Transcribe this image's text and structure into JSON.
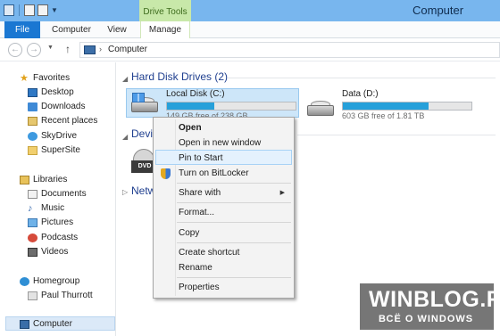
{
  "window": {
    "title": "Computer",
    "context_tab": "Drive Tools"
  },
  "ribbon": {
    "tabs": [
      "File",
      "Computer",
      "View",
      "Manage"
    ]
  },
  "address": {
    "path": "Computer"
  },
  "nav": {
    "favorites": {
      "label": "Favorites",
      "items": [
        "Desktop",
        "Downloads",
        "Recent places",
        "SkyDrive",
        "SuperSite"
      ]
    },
    "libraries": {
      "label": "Libraries",
      "items": [
        "Documents",
        "Music",
        "Pictures",
        "Podcasts",
        "Videos"
      ]
    },
    "homegroup": {
      "label": "Homegroup",
      "items": [
        "Paul Thurrott"
      ]
    },
    "computer": {
      "label": "Computer"
    }
  },
  "content": {
    "groups": {
      "hard_disk_drives": "Hard Disk Drives (2)",
      "devices_partial": "Devi",
      "network_partial": "Netw"
    },
    "drives": [
      {
        "name": "Local Disk (C:)",
        "free_text": "149 GB free of 238 GB",
        "used_fraction": 0.37
      },
      {
        "name": "Data (D:)",
        "free_text": "603 GB free of 1.81 TB",
        "used_fraction": 0.67
      }
    ],
    "dvd_label": "DVD"
  },
  "context_menu": {
    "items": [
      "Open",
      "Open in new window",
      "Pin to Start",
      "Turn on BitLocker",
      "Share with",
      "Format...",
      "Copy",
      "Create shortcut",
      "Rename",
      "Properties"
    ]
  },
  "watermark": {
    "title": "WINBLOG.RU",
    "subtitle": "ВСЁ О WINDOWS"
  },
  "colors": {
    "titlebar": "#78b6ee",
    "file_tab": "#1a77d2",
    "drive_tools": "#c8e8a9",
    "selection": "#cde6f9",
    "bar_fill": "#26a0da"
  }
}
